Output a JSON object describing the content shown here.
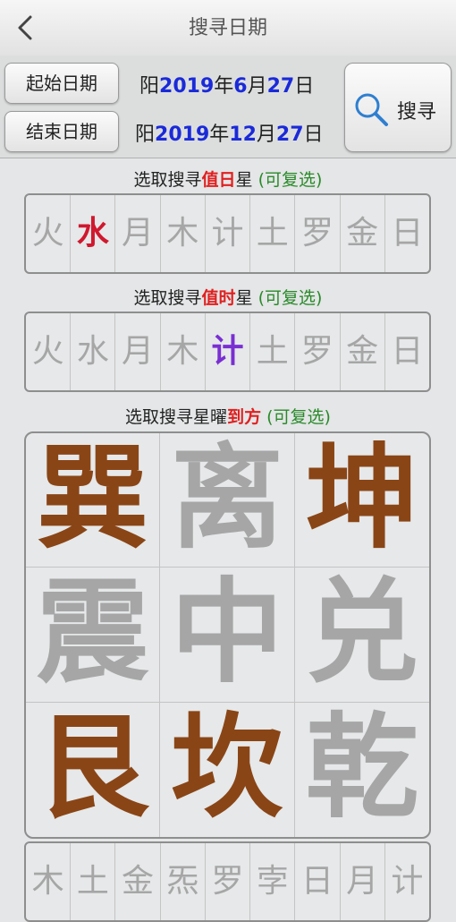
{
  "header": {
    "title": "搜寻日期"
  },
  "dates": {
    "start_button": "起始日期",
    "end_button": "结束日期",
    "start": {
      "prefix": "阳",
      "year": "2019",
      "y": "年",
      "month": "6",
      "m": "月",
      "day": "27",
      "d": "日"
    },
    "end": {
      "prefix": "阳",
      "year": "2019",
      "y": "年",
      "month": "12",
      "m": "月",
      "day": "27",
      "d": "日"
    },
    "search_button": "搜寻"
  },
  "day_star": {
    "label_pre": "选取搜寻",
    "label_hl": "值日",
    "label_post": "星",
    "label_note": "(可复选)",
    "items": [
      "火",
      "水",
      "月",
      "木",
      "计",
      "土",
      "罗",
      "金",
      "日"
    ],
    "selected": "水"
  },
  "hour_star": {
    "label_pre": "选取搜寻",
    "label_hl": "值时",
    "label_post": "星",
    "label_note": "(可复选)",
    "items": [
      "火",
      "水",
      "月",
      "木",
      "计",
      "土",
      "罗",
      "金",
      "日"
    ],
    "selected": "计"
  },
  "direction": {
    "label_pre": "选取搜寻星曜",
    "label_hl": "到方",
    "label_note": "(可复选)",
    "items": [
      "巽",
      "离",
      "坤",
      "震",
      "中",
      "兑",
      "艮",
      "坎",
      "乾"
    ],
    "selected": [
      "巽",
      "坤",
      "艮",
      "坎"
    ]
  },
  "bottom_row": {
    "items": [
      "木",
      "土",
      "金",
      "炁",
      "罗",
      "孛",
      "日",
      "月",
      "计"
    ]
  },
  "colors": {
    "selected_brown": "#8a4516",
    "selected_red": "#d0182e",
    "selected_purple": "#7a2fd2",
    "date_blue": "#1a2ad8"
  }
}
